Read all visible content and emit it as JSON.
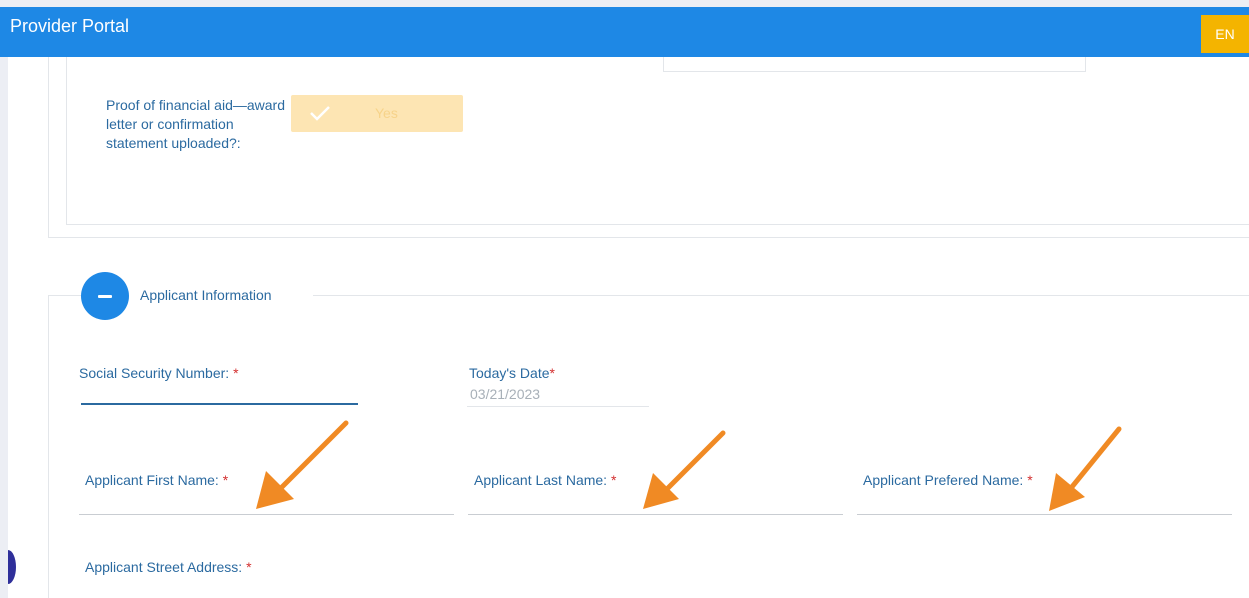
{
  "header": {
    "title": "Provider Portal",
    "language_button": "EN"
  },
  "financial_aid": {
    "label": "Proof of financial aid—award letter or confirmation statement uploaded?:",
    "toggle_value": "Yes",
    "toggle_icon": "check-icon"
  },
  "applicant_section": {
    "title": "Applicant Information",
    "toggle_icon": "minus-icon",
    "fields": {
      "ssn": {
        "label": "Social Security Number:",
        "required": "*"
      },
      "todays_date": {
        "label": "Today's Date",
        "required": "*",
        "value": "03/21/2023"
      },
      "first_name": {
        "label": "Applicant First Name:",
        "required": "*"
      },
      "last_name": {
        "label": "Applicant Last Name:",
        "required": "*"
      },
      "preferred_name": {
        "label": "Applicant Prefered Name:",
        "required": "*"
      },
      "street_address": {
        "label": "Applicant Street Address:",
        "required": "*"
      }
    }
  },
  "annotations": {
    "arrow_color": "#f08a24",
    "arrow_icon": "arrow-pointer-icon"
  },
  "colors": {
    "header_bg": "#1e88e5",
    "language_bg": "#f4b400",
    "label_text": "#2b6aa0",
    "required": "#d32f2f"
  }
}
